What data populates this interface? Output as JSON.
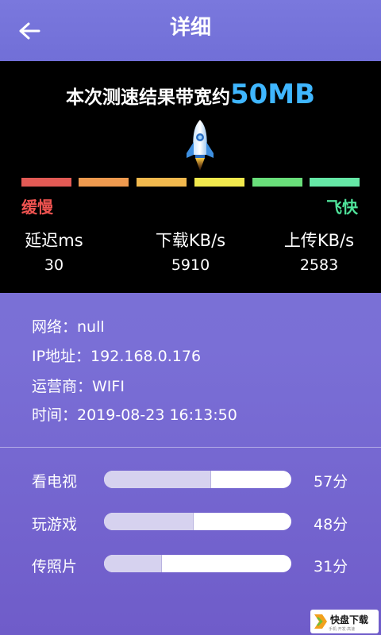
{
  "header": {
    "title": "详细",
    "back_icon": "arrow-left-icon"
  },
  "speed": {
    "result_text": "本次测速结果带宽约",
    "result_value": "50MB",
    "rocket_icon": "rocket-icon",
    "scale_colors": [
      "#e25a55",
      "#ee9a4f",
      "#f2b94e",
      "#f2e94d",
      "#69de7a",
      "#65e7a6"
    ],
    "slow_label": "缓慢",
    "fast_label": "飞快",
    "slow_color": "#ef5350",
    "fast_color": "#4fe39a"
  },
  "stats": [
    {
      "label": "延迟ms",
      "value": "30"
    },
    {
      "label": "下载KB/s",
      "value": "5910"
    },
    {
      "label": "上传KB/s",
      "value": "2583"
    }
  ],
  "info": {
    "network": "网络：null",
    "ip": "IP地址：192.168.0.176",
    "carrier": "运营商：WIFI",
    "time": "时间：2019-08-23 16:13:50"
  },
  "scores": [
    {
      "label": "看电视",
      "score": "57分",
      "fraction": 0.57
    },
    {
      "label": "玩游戏",
      "score": "48分",
      "fraction": 0.48
    },
    {
      "label": "传照片",
      "score": "31分",
      "fraction": 0.31
    }
  ],
  "watermark": {
    "text": "快盘下载",
    "sub": "手机·开发·高速"
  }
}
